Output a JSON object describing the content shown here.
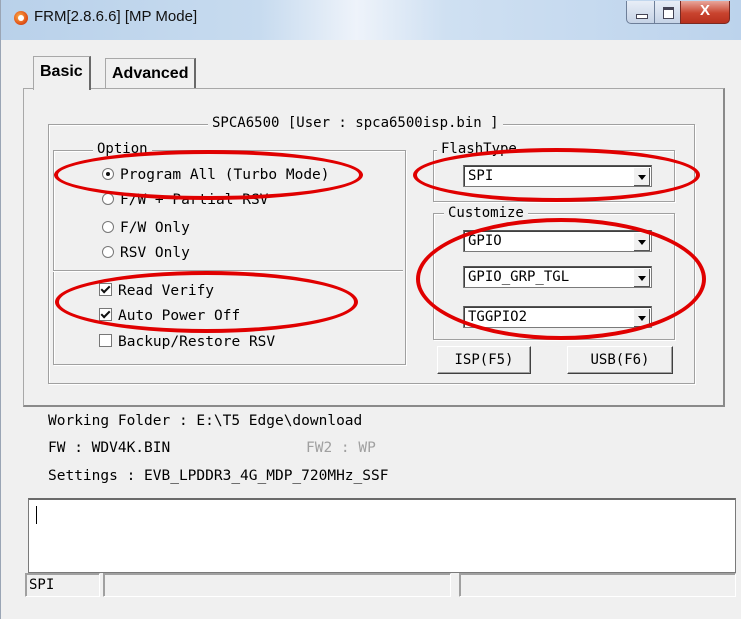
{
  "window": {
    "title": "FRM[2.8.6.6] [MP Mode]",
    "close_glyph": "X"
  },
  "tabs": [
    {
      "label": "Basic",
      "active": true
    },
    {
      "label": "Advanced",
      "active": false
    }
  ],
  "main_group": {
    "title": "SPCA6500 [User : spca6500isp.bin ]"
  },
  "option": {
    "legend": "Option",
    "radios": [
      {
        "label": "Program All (Turbo Mode)",
        "selected": true
      },
      {
        "label": "F/W + Partial RSV",
        "selected": false
      },
      {
        "label": "F/W Only",
        "selected": false
      },
      {
        "label": "RSV Only",
        "selected": false
      }
    ],
    "checks": [
      {
        "label": "Read Verify",
        "checked": true
      },
      {
        "label": "Auto Power Off",
        "checked": true
      },
      {
        "label": "Backup/Restore RSV",
        "checked": false
      }
    ]
  },
  "flash_type": {
    "legend": "FlashType",
    "value": "SPI"
  },
  "customize": {
    "legend": "Customize",
    "combos": [
      "GPIO",
      "GPIO_GRP_TGL",
      "TGGPIO2"
    ]
  },
  "buttons": {
    "isp": "ISP(F5)",
    "usb": "USB(F6)"
  },
  "info": {
    "working_folder": "Working Folder : E:\\T5 Edge\\download",
    "fw": "FW : WDV4K.BIN",
    "fw2": "FW2 : WP",
    "settings": "Settings : EVB_LPDDR3_4G_MDP_720MHz_SSF"
  },
  "statusbar": {
    "pane1": "SPI",
    "pane2": "",
    "pane3": ""
  },
  "colors": {
    "highlight": "#e00000",
    "window_bg": "#f0f0f0"
  }
}
